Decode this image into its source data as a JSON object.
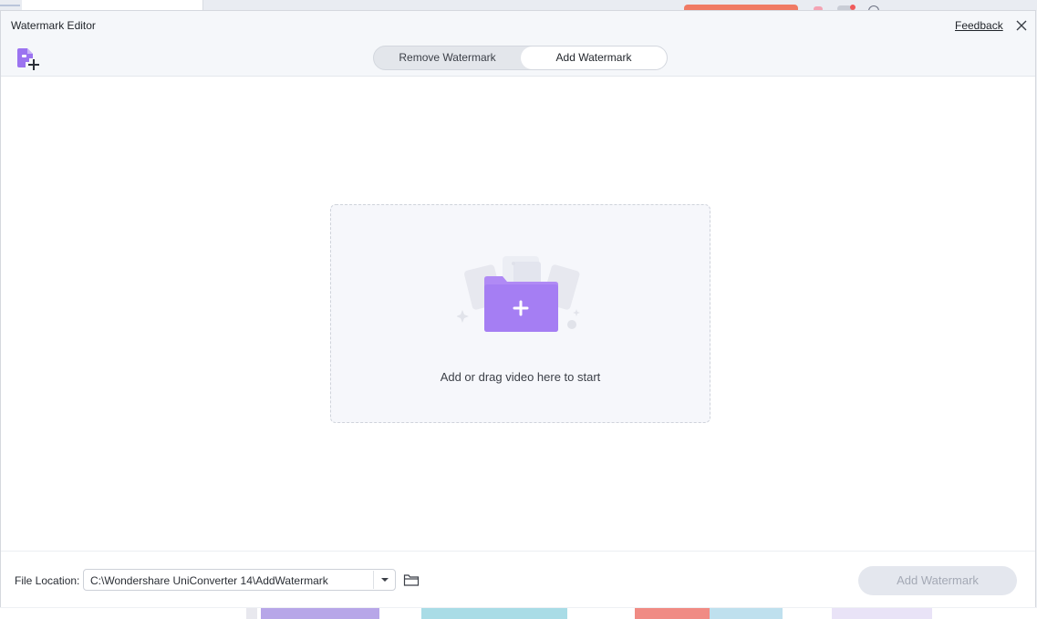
{
  "dialog": {
    "title": "Watermark Editor",
    "feedback_label": "Feedback",
    "tabs": [
      {
        "label": "Remove Watermark",
        "active": false
      },
      {
        "label": "Add Watermark",
        "active": true
      }
    ]
  },
  "dropzone": {
    "prompt": "Add or drag video here to start"
  },
  "footer": {
    "file_location_label": "File Location:",
    "file_location_value": "C:\\Wondershare UniConverter 14\\AddWatermark",
    "action_button_label": "Add Watermark",
    "action_button_enabled": false
  },
  "colors": {
    "accent_purple": "#9b73f0",
    "disabled_button": "#e4e7ee",
    "header_bg": "#f5f7fa"
  }
}
